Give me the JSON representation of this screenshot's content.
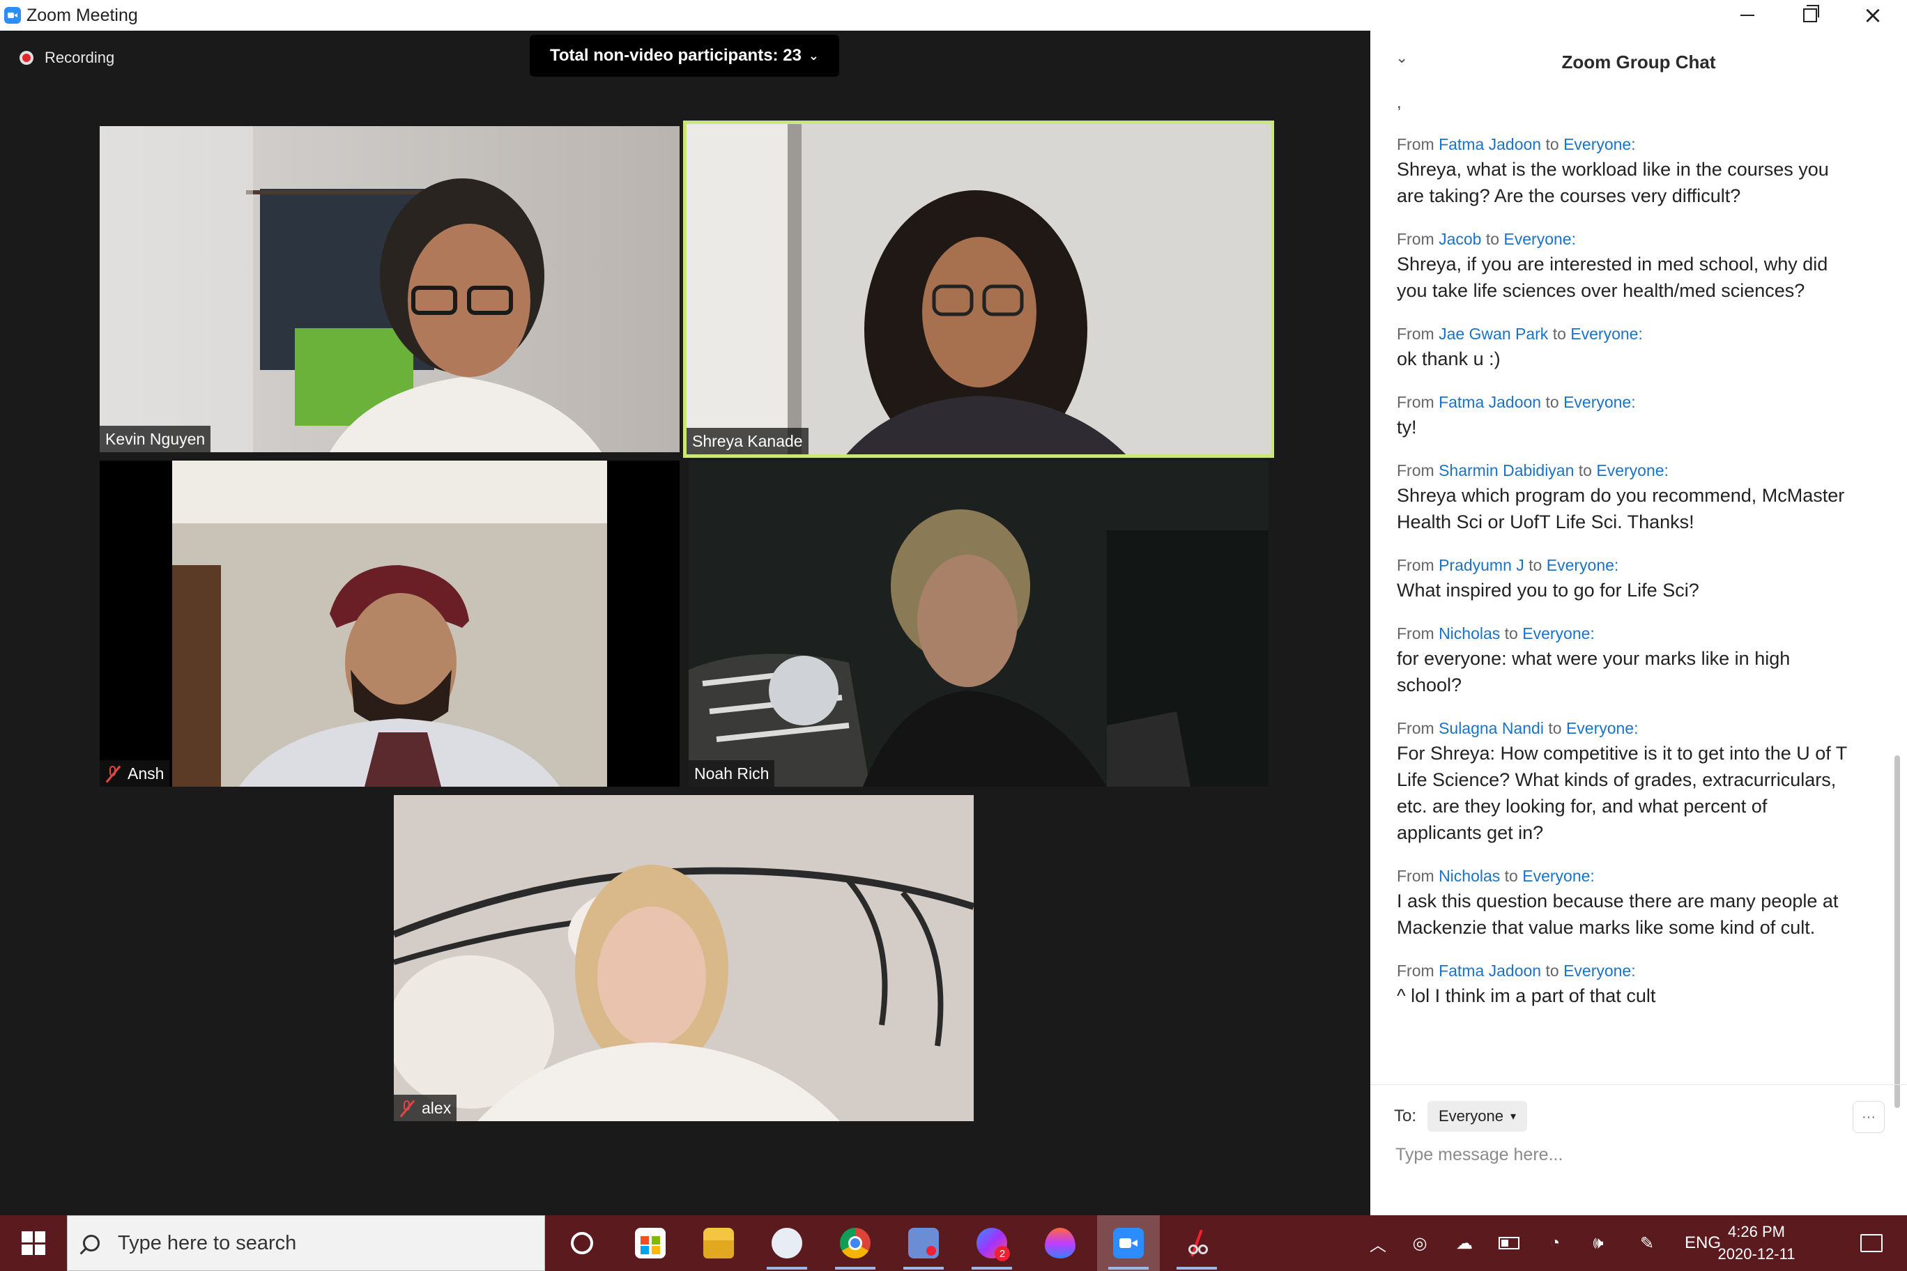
{
  "window": {
    "title": "Zoom Meeting"
  },
  "meeting": {
    "recording_label": "Recording",
    "participants_pill": "Total non-video participants: 23",
    "tiles": [
      {
        "name": "Kevin Nguyen",
        "muted": false,
        "active": false
      },
      {
        "name": "Shreya Kanade",
        "muted": false,
        "active": true
      },
      {
        "name": "Ansh",
        "muted": true,
        "active": false
      },
      {
        "name": "Noah Rich",
        "muted": false,
        "active": false
      },
      {
        "name": "alex",
        "muted": true,
        "active": false
      }
    ]
  },
  "chat": {
    "title": "Zoom Group Chat",
    "stray_char": ",",
    "from_word": "From",
    "to_word": "to",
    "messages": [
      {
        "sender": "Fatma Jadoon",
        "recipient": "Everyone:",
        "text": "Shreya, what is the workload like in the courses you are taking? Are the courses very difficult?"
      },
      {
        "sender": "Jacob",
        "recipient": "Everyone:",
        "text": "Shreya, if you are interested in med school, why did you take life sciences over health/med sciences?"
      },
      {
        "sender": "Jae Gwan Park",
        "recipient": "Everyone:",
        "text": "ok thank u :)"
      },
      {
        "sender": "Fatma Jadoon",
        "recipient": "Everyone:",
        "text": "ty!"
      },
      {
        "sender": "Sharmin Dabidiyan",
        "recipient": "Everyone:",
        "text": "Shreya which program do you recommend, McMaster Health Sci or UofT Life Sci. Thanks!"
      },
      {
        "sender": "Pradyumn J",
        "recipient": "Everyone:",
        "text": "What inspired you to go for Life Sci?"
      },
      {
        "sender": "Nicholas",
        "recipient": "Everyone:",
        "text": "for everyone: what were your marks like in high school?"
      },
      {
        "sender": "Sulagna Nandi",
        "recipient": "Everyone:",
        "text": "For Shreya: How competitive is it to get into the U of T Life Science? What kinds of grades, extracurriculars, etc. are they looking for, and what percent of applicants get in?"
      },
      {
        "sender": "Nicholas",
        "recipient": "Everyone:",
        "text": "I ask this question because there are many people at Mackenzie that value marks like some kind of cult."
      },
      {
        "sender": "Fatma Jadoon",
        "recipient": "Everyone:",
        "text": "^ lol I think im a part of that cult"
      }
    ],
    "to_label": "To:",
    "to_value": "Everyone",
    "input_placeholder": "Type message here..."
  },
  "taskbar": {
    "search_placeholder": "Type here to search",
    "apps": [
      "microsoft-store-icon",
      "file-explorer-icon",
      "paint-icon",
      "chrome-icon",
      "snip-icon",
      "messenger-icon",
      "paint3d-icon",
      "zoom-icon",
      "snipping-tool-icon"
    ],
    "messenger_badge": "2",
    "language": "ENG",
    "time": "4:26 PM",
    "date": "2020-12-11"
  },
  "colors": {
    "accent_blue": "#1a73c8",
    "active_speaker": "#c9e77a",
    "taskbar": "#5a1a1e",
    "zoom_blue": "#2d8cff"
  }
}
